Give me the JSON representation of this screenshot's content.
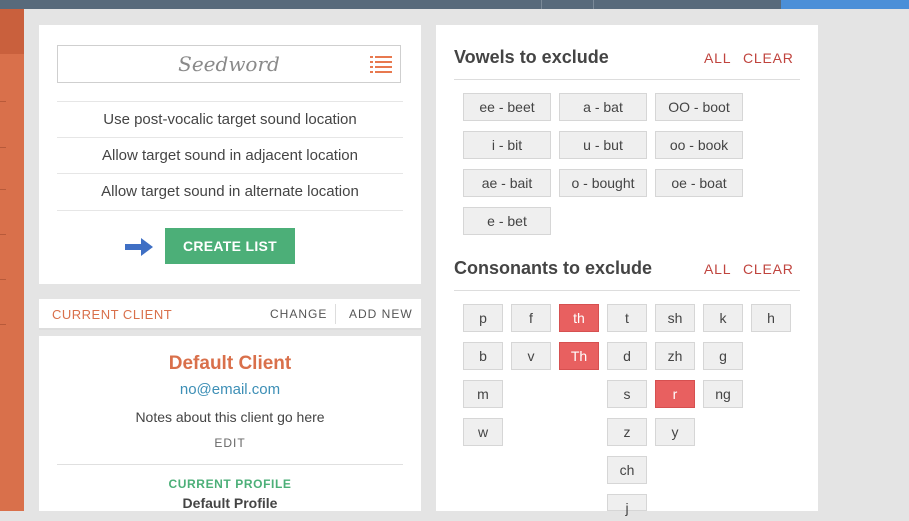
{
  "seed": {
    "placeholder": "Seedword",
    "list_icon": "list-icon"
  },
  "options": [
    "Use post-vocalic target sound location",
    "Allow target sound in adjacent location",
    "Allow target sound in alternate location"
  ],
  "create_label": "CREATE LIST",
  "client": {
    "header_label": "CURRENT CLIENT",
    "change_label": "CHANGE",
    "add_new_label": "ADD NEW",
    "name": "Default Client",
    "email": "no@email.com",
    "notes": "Notes about this client go here",
    "edit_label": "EDIT",
    "profile_label": "CURRENT PROFILE",
    "profile_name": "Default Profile"
  },
  "vowels": {
    "title": "Vowels to exclude",
    "all": "ALL",
    "clear": "CLEAR",
    "items": [
      {
        "label": "ee - beet",
        "on": false
      },
      {
        "label": "a - bat",
        "on": false
      },
      {
        "label": "OO - boot",
        "on": false
      },
      {
        "label": "i - bit",
        "on": false
      },
      {
        "label": "u - but",
        "on": false
      },
      {
        "label": "oo - book",
        "on": false
      },
      {
        "label": "ae - bait",
        "on": false
      },
      {
        "label": "o - bought",
        "on": false
      },
      {
        "label": "oe - boat",
        "on": false
      },
      {
        "label": "e - bet",
        "on": false
      }
    ]
  },
  "consonants": {
    "title": "Consonants to exclude",
    "all": "ALL",
    "clear": "CLEAR",
    "items": [
      {
        "label": "p",
        "on": false
      },
      {
        "label": "f",
        "on": false
      },
      {
        "label": "th",
        "on": true
      },
      {
        "label": "t",
        "on": false
      },
      {
        "label": "sh",
        "on": false
      },
      {
        "label": "k",
        "on": false
      },
      {
        "label": "h",
        "on": false
      },
      {
        "label": "b",
        "on": false
      },
      {
        "label": "v",
        "on": false
      },
      {
        "label": "Th",
        "on": true
      },
      {
        "label": "d",
        "on": false
      },
      {
        "label": "zh",
        "on": false
      },
      {
        "label": "g",
        "on": false
      },
      {
        "label": "m",
        "on": false
      },
      {
        "label": "s",
        "on": false
      },
      {
        "label": "r",
        "on": true
      },
      {
        "label": "ng",
        "on": false
      },
      {
        "label": "w",
        "on": false
      },
      {
        "label": "z",
        "on": false
      },
      {
        "label": "y",
        "on": false
      },
      {
        "label": "ch",
        "on": false
      },
      {
        "label": "j",
        "on": false
      }
    ]
  },
  "colors": {
    "accent_orange": "#d9704b",
    "accent_green": "#4caf78",
    "selected_red": "#e86060",
    "link_red": "#c0443e",
    "email_blue": "#3d8fb6"
  }
}
